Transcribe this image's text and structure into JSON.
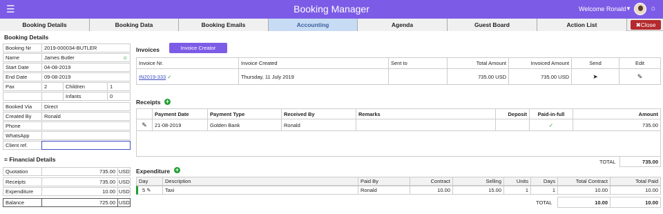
{
  "app": {
    "title": "Booking Manager",
    "welcome": "Welcome Ronald"
  },
  "tabs": [
    "Booking Details",
    "Booking Data",
    "Booking Emails",
    "Accounting",
    "Agenda",
    "Guest Board",
    "Action List"
  ],
  "close_label": "Close",
  "booking": {
    "title": "Booking Details",
    "rows": [
      {
        "label": "Booking Nr",
        "value": "2019-000034-BUTLER"
      },
      {
        "label": "Name",
        "value": "James Butler"
      },
      {
        "label": "Start Date",
        "value": "04-08-2019"
      },
      {
        "label": "End Date",
        "value": "09-08-2019"
      }
    ],
    "pax_label": "Pax",
    "pax_value": "2",
    "children_label": "Children",
    "children_value": "1",
    "infants_label": "Infants",
    "infants_value": "0",
    "rows2": [
      {
        "label": "Booked Via",
        "value": "Direct"
      },
      {
        "label": "Created By",
        "value": "Ronald"
      },
      {
        "label": "Phone",
        "value": ""
      },
      {
        "label": "WhatsApp",
        "value": ""
      },
      {
        "label": "Client ref.",
        "value": ""
      }
    ]
  },
  "financial": {
    "title": "Financial Details",
    "rows": [
      {
        "label": "Quotation",
        "value": "735.00",
        "cur": "USD"
      },
      {
        "label": "Receipts",
        "value": "735.00",
        "cur": "USD"
      },
      {
        "label": "Expenditure",
        "value": "10.00",
        "cur": "USD"
      }
    ],
    "balance": {
      "label": "Balance",
      "value": "725.00",
      "cur": "USD"
    }
  },
  "invoices": {
    "title": "Invoices",
    "creator_label": "Invoice Creator",
    "headers": [
      "Invoice Nr.",
      "Invoice Created",
      "Sent to",
      "Total Amount",
      "Invoiced Amount",
      "Send",
      "Edit"
    ],
    "row": {
      "nr": "IN2019-333",
      "created": "Thursday, 11 July 2019",
      "sent_to": "",
      "total": "735.00 USD",
      "invoiced": "735.00 USD"
    }
  },
  "receipts": {
    "title": "Receipts",
    "headers": [
      "Payment Date",
      "Payment Type",
      "Received By",
      "Remarks",
      "Deposit",
      "Paid-in-full",
      "Amount"
    ],
    "row": {
      "date": "21-08-2019",
      "type": "Golden Bank",
      "received_by": "Ronald",
      "remarks": "",
      "deposit": "",
      "amount": "735.00"
    },
    "total_label": "TOTAL",
    "total_value": "735.00"
  },
  "expenditure": {
    "title": "Expenditure",
    "headers": [
      "Day",
      "Description",
      "Paid By",
      "Contract",
      "Selling",
      "Units",
      "Days",
      "Total Contract",
      "Total Paid"
    ],
    "row": {
      "day": "5",
      "description": "Taxi",
      "paid_by": "Ronald",
      "contract": "10.00",
      "selling": "15.00",
      "units": "1",
      "days": "1",
      "total_contract": "10.00",
      "total_paid": "10.00"
    },
    "total_label": "TOTAL",
    "total_contract": "10.00",
    "total_paid": "10.00"
  }
}
